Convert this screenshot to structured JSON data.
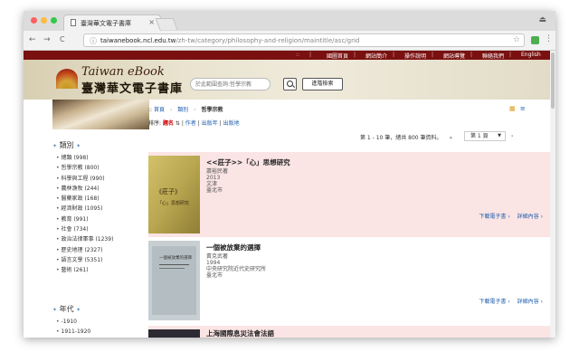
{
  "browser": {
    "tab_title": "臺灣華文電子書庫",
    "tab_close": "×",
    "url_host": "taiwanebook.ncl.edu.tw",
    "url_path": "/zh-tw/category/philosophy-and-religion/maintitle/asc/grid",
    "back": "←",
    "forward": "→",
    "reload": "C",
    "lock": "ⓘ",
    "star": "☆",
    "menu": "⋮",
    "profile": "⏏",
    "traffic_colors": [
      "#fc605c",
      "#fdbc40",
      "#34c84a"
    ]
  },
  "topnav": {
    "items": [
      "國圖首頁",
      "網站簡介",
      "操作說明",
      "網站導覽",
      "聯絡我們",
      "English"
    ],
    "sep": "|",
    "lead": "::"
  },
  "header": {
    "logo_en": "Taiwan eBook",
    "logo_zh": "臺灣華文電子書庫",
    "search_placeholder": "於此範圍查詢:哲學宗教",
    "advanced_search": "進階檢索"
  },
  "sidebar": {
    "category_heading": "類別",
    "categories": [
      "總類 (998)",
      "哲學宗教 (800)",
      "科學與工程 (990)",
      "農林漁牧 (244)",
      "醫藥家政 (168)",
      "經濟財政 (1095)",
      "教育 (991)",
      "社會 (734)",
      "政治法律軍事 (1239)",
      "歷史地理 (2327)",
      "語言文學 (5351)",
      "藝術 (261)"
    ],
    "era_heading": "年代",
    "eras": [
      "-1910",
      "1911-1920"
    ],
    "heading_ornament": "✦"
  },
  "main": {
    "breadcrumb": [
      "首頁",
      "類別",
      "哲學宗教"
    ],
    "crumb_lead": "::",
    "crumb_arrow": "›",
    "sort_label": "排序:",
    "sort_active": "題名",
    "sort_active_icon": "⇅",
    "sort_options": [
      "作者",
      "出版年",
      "出版地"
    ],
    "sort_sep": "|",
    "view_icons": [
      "▦",
      "≡"
    ],
    "pager_text": "第 1 - 10 筆，總共 800 筆資料。",
    "pager_prev": "«",
    "page_select": "第 1 頁",
    "page_caret": "▼",
    "pager_next": "›"
  },
  "records": [
    {
      "title": "<<莊子>>「心」思想研究",
      "author": "蕭裕民著",
      "year": "2013",
      "publisher": "文津",
      "place": "臺北市",
      "download": "下載電子書",
      "details": "詳細內容",
      "cover_text": "《莊子》「心」思想研究",
      "bg": "#fbe4e4"
    },
    {
      "title": "一個被放棄的選擇",
      "author": "黃克武著",
      "year": "1994",
      "publisher": "中央研究院近代史研究所",
      "place": "臺北市",
      "download": "下載電子書",
      "details": "詳細內容",
      "cover_text": "一個被放棄的選擇",
      "bg": "#ffffff"
    },
    {
      "title": "上海國際息災法會法語",
      "bg": "#fbe4e4"
    }
  ],
  "icons": {
    "action_arrow": "›"
  }
}
